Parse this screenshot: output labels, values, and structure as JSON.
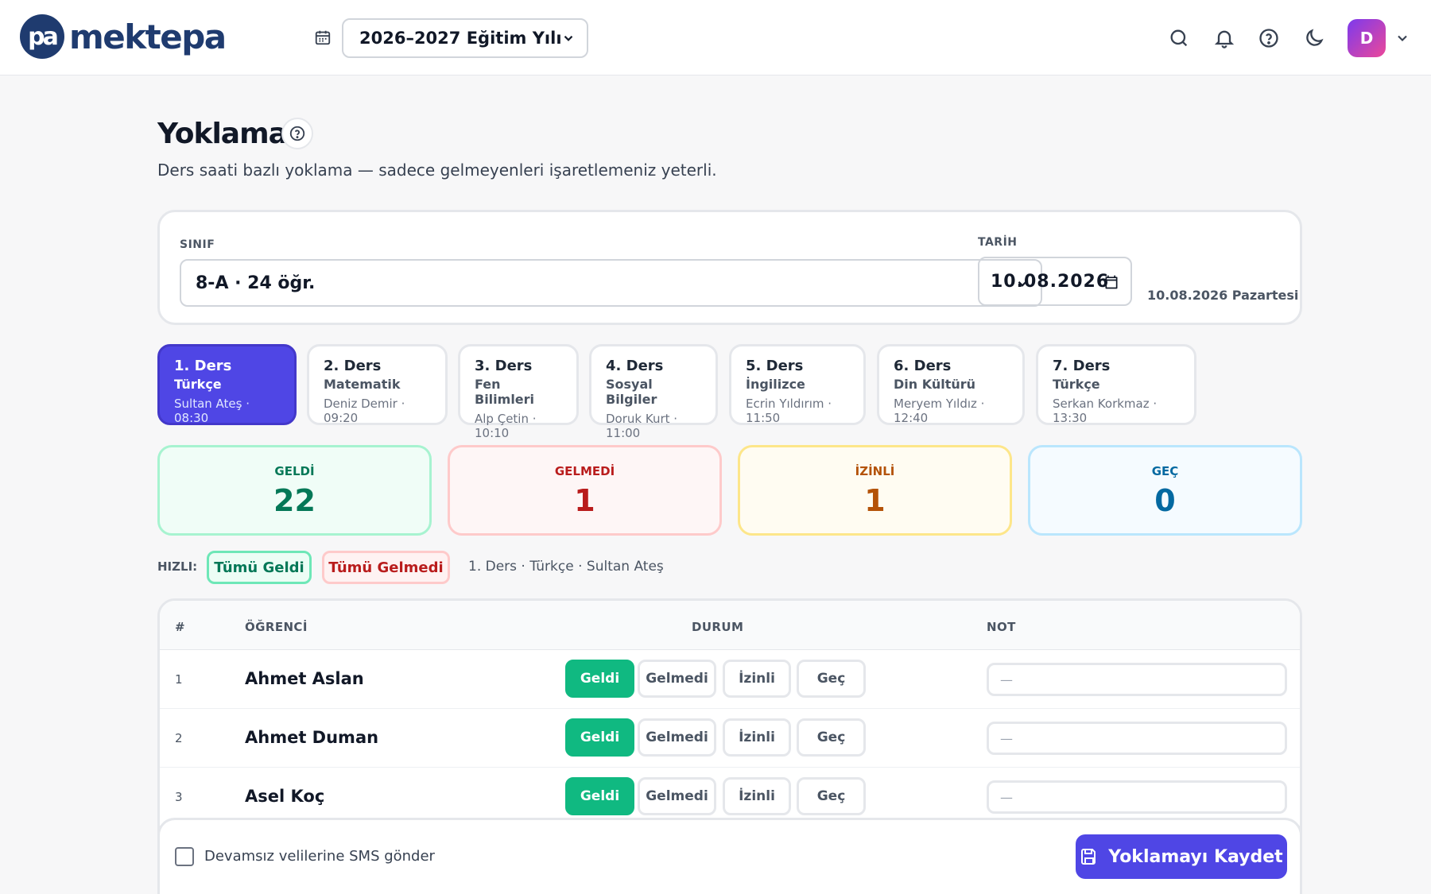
{
  "app": {
    "logo_mark": "pa",
    "logo_text": "mektepa"
  },
  "header": {
    "year_value": "2026–2027 Eğitim Yılı",
    "avatar_initial": "D"
  },
  "page": {
    "title": "Yoklama",
    "subtitle": "Ders saati bazlı yoklama — sadece gelmeyenleri işaretlemeniz yeterli."
  },
  "filters": {
    "class_label": "SINIF",
    "class_value": "8-A · 24 öğr.",
    "date_label": "TARİH",
    "date_value": "10.08.2026",
    "date_note": "10.08.2026 Pazartesi"
  },
  "periods": [
    {
      "title": "1. Ders",
      "subject": "Türkçe",
      "meta": "Sultan Ateş · 08:30",
      "active": true
    },
    {
      "title": "2. Ders",
      "subject": "Matematik",
      "meta": "Deniz Demir · 09:20",
      "active": false
    },
    {
      "title": "3. Ders",
      "subject": "Fen Bilimleri",
      "meta": "Alp Çetin · 10:10",
      "active": false
    },
    {
      "title": "4. Ders",
      "subject": "Sosyal Bilgiler",
      "meta": "Doruk Kurt · 11:00",
      "active": false
    },
    {
      "title": "5. Ders",
      "subject": "İngilizce",
      "meta": "Ecrin Yıldırım · 11:50",
      "active": false
    },
    {
      "title": "6. Ders",
      "subject": "Din Kültürü",
      "meta": "Meryem Yıldız · 12:40",
      "active": false
    },
    {
      "title": "7. Ders",
      "subject": "Türkçe",
      "meta": "Serkan Korkmaz · 13:30",
      "active": false
    }
  ],
  "stats": [
    {
      "label": "GELDİ",
      "value": "22",
      "color": "#047857",
      "bg": "#f0fdf7",
      "border": "#a7f3d0"
    },
    {
      "label": "GELMEDİ",
      "value": "1",
      "color": "#b91c1c",
      "bg": "#fef6f6",
      "border": "#fecaca"
    },
    {
      "label": "İZİNLİ",
      "value": "1",
      "color": "#b45309",
      "bg": "#fffcf2",
      "border": "#fde68a"
    },
    {
      "label": "GEÇ",
      "value": "0",
      "color": "#0369a1",
      "bg": "#f5fbff",
      "border": "#bae6fd"
    }
  ],
  "quick": {
    "label": "HIZLI:",
    "all_present": "Tümü Geldi",
    "all_absent": "Tümü Gelmedi",
    "info": "1. Ders · Türkçe · Sultan Ateş"
  },
  "table": {
    "headers": {
      "num": "#",
      "student": "ÖĞRENCİ",
      "status": "DURUM",
      "note": "NOT"
    },
    "status_options": [
      "Geldi",
      "Gelmedi",
      "İzinli",
      "Geç"
    ],
    "rows": [
      {
        "num": "1",
        "name": "Ahmet Aslan",
        "status": "Geldi",
        "note": "—"
      },
      {
        "num": "2",
        "name": "Ahmet Duman",
        "status": "Geldi",
        "note": "—"
      },
      {
        "num": "3",
        "name": "Asel Koç",
        "status": "Geldi",
        "note": "—"
      }
    ]
  },
  "footer": {
    "sms_label": "Devamsız velilerine SMS gönder",
    "sms_checked": false,
    "save_label": "Yoklamayı Kaydet"
  },
  "colors": {
    "accent": "#4f46e5",
    "present": "#10b981",
    "brand": "#1f3b6f"
  }
}
